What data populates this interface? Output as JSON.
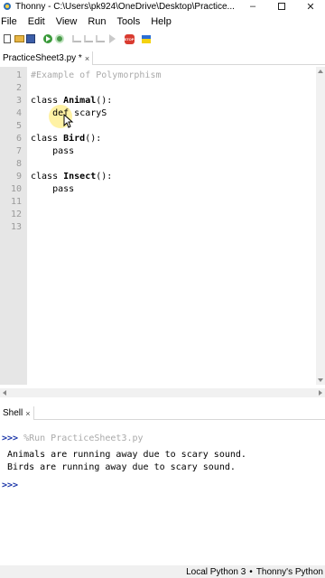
{
  "window": {
    "title": "Thonny  -  C:\\Users\\pk924\\OneDrive\\Desktop\\Practice...",
    "minimize_icon": "minimize-icon",
    "maximize_icon": "maximize-icon",
    "close_icon": "close-icon"
  },
  "menu": {
    "items": [
      "File",
      "Edit",
      "View",
      "Run",
      "Tools",
      "Help"
    ]
  },
  "toolbar": {
    "icons": [
      "new-file-icon",
      "open-file-icon",
      "save-icon",
      "run-icon",
      "debug-icon",
      "step-over-icon",
      "step-into-icon",
      "step-out-icon",
      "resume-icon",
      "stop-icon",
      "support-ukraine-icon"
    ],
    "stop_label": "STOP"
  },
  "editor": {
    "tab_label": "PracticeSheet3.py *",
    "tab_close": "×",
    "line_numbers": [
      "1",
      "2",
      "3",
      "4",
      "5",
      "6",
      "7",
      "8",
      "9",
      "10",
      "11",
      "12",
      "13"
    ],
    "lines": {
      "l1": "#Example of Polymorphism",
      "l3_kw": "class ",
      "l3_name": "Animal",
      "l3_rest": "():",
      "l4_indent": "    ",
      "l4_kw": "def",
      "l4_rest": " scaryS",
      "l6_kw": "class ",
      "l6_name": "Bird",
      "l6_rest": "():",
      "l7": "    pass",
      "l9_kw": "class ",
      "l9_name": "Insect",
      "l9_rest": "():",
      "l10": "    pass"
    }
  },
  "shell": {
    "tab_label": "Shell",
    "tab_close": "×",
    "prompt": ">>>",
    "run_command": " %Run PracticeSheet3.py",
    "output": [
      " Animals are running away due to scary sound.",
      " Birds are running away due to scary sound."
    ],
    "empty_prompt": ">>>"
  },
  "status": {
    "interpreter": "Local Python 3",
    "separator": "•",
    "runtime": "Thonny's Python"
  }
}
